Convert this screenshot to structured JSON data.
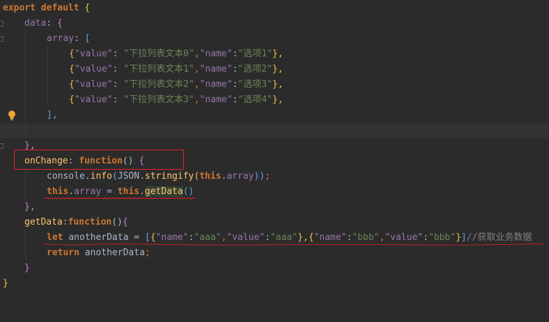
{
  "editor": {
    "line1": {
      "kw": "export",
      "kw2": "default",
      "brace": "{"
    },
    "line2": {
      "prop": "data",
      "colon": ":",
      "brace": "{"
    },
    "line3": {
      "prop": "array",
      "colon": ":",
      "bracket": "["
    },
    "items": [
      {
        "open": "{",
        "k1": "\"value\"",
        "v1": "\"下拉列表文本0\"",
        "k2": "\"name\"",
        "v2": "\"选项1\"",
        "close": "},"
      },
      {
        "open": "{",
        "k1": "\"value\"",
        "v1": "\"下拉列表文本1\"",
        "k2": "\"name\"",
        "v2": "\"选项2\"",
        "close": "},"
      },
      {
        "open": "{",
        "k1": "\"value\"",
        "v1": "\"下拉列表文本2\"",
        "k2": "\"name\"",
        "v2": "\"选项3\"",
        "close": "},"
      },
      {
        "open": "{",
        "k1": "\"value\"",
        "v1": "\"下拉列表文本3\"",
        "k2": "\"name\"",
        "v2": "\"选项4\"",
        "close": "},"
      }
    ],
    "line8": {
      "close": "],"
    },
    "line10": {
      "close": "},"
    },
    "line11": {
      "name": "onChange",
      "colon": ":",
      "kw": "function",
      "paren": "()",
      "brace": "{"
    },
    "line12": {
      "obj": "console",
      "dot": ".",
      "method": "info",
      "p1": "(",
      "json": "JSON",
      "dot2": ".",
      "fn": "stringify",
      "p2": "(",
      "this": "this",
      "dot3": ".",
      "prop": "array",
      "p3": "))",
      "semi": ";"
    },
    "line13": {
      "this": "this",
      "dot": ".",
      "prop": "array",
      "eq": " = ",
      "this2": "this",
      "dot2": ".",
      "fn": "getData",
      "paren": "()"
    },
    "line14": {
      "close": "},"
    },
    "line15": {
      "name": "getData",
      "colon": ":",
      "kw": "function",
      "paren": "()",
      "brace": "{"
    },
    "line16": {
      "kw": "let",
      "var": "anotherData",
      "eq": " = ",
      "ob": "[",
      "o1": "{",
      "k1": "\"name\"",
      "c1": ":",
      "v1": "\"aaa\"",
      "cm1": ",",
      "k2": "\"value\"",
      "c2": ":",
      "v2": "\"aaa\"",
      "cb1": "},",
      "o2": "{",
      "k3": "\"name\"",
      "c3": ":",
      "v3": "\"bbb\"",
      "cm2": ",",
      "k4": "\"value\"",
      "c4": ":",
      "v4": "\"bbb\"",
      "cb2": "}",
      "cbk": "]",
      "comment": "//获取业务数据"
    },
    "line17": {
      "kw": "return",
      "var": "anotherData",
      "semi": ";"
    },
    "line18": {
      "close": "}"
    },
    "line19": {
      "close": "}"
    }
  },
  "colors": {
    "background": "#2b2b2b",
    "keyword": "#cc7832",
    "property": "#9876aa",
    "string": "#6a8759",
    "function": "#ffc66d",
    "highlight_box": "#e8232b"
  },
  "icons": {
    "intention_bulb": "lightbulb-icon"
  }
}
